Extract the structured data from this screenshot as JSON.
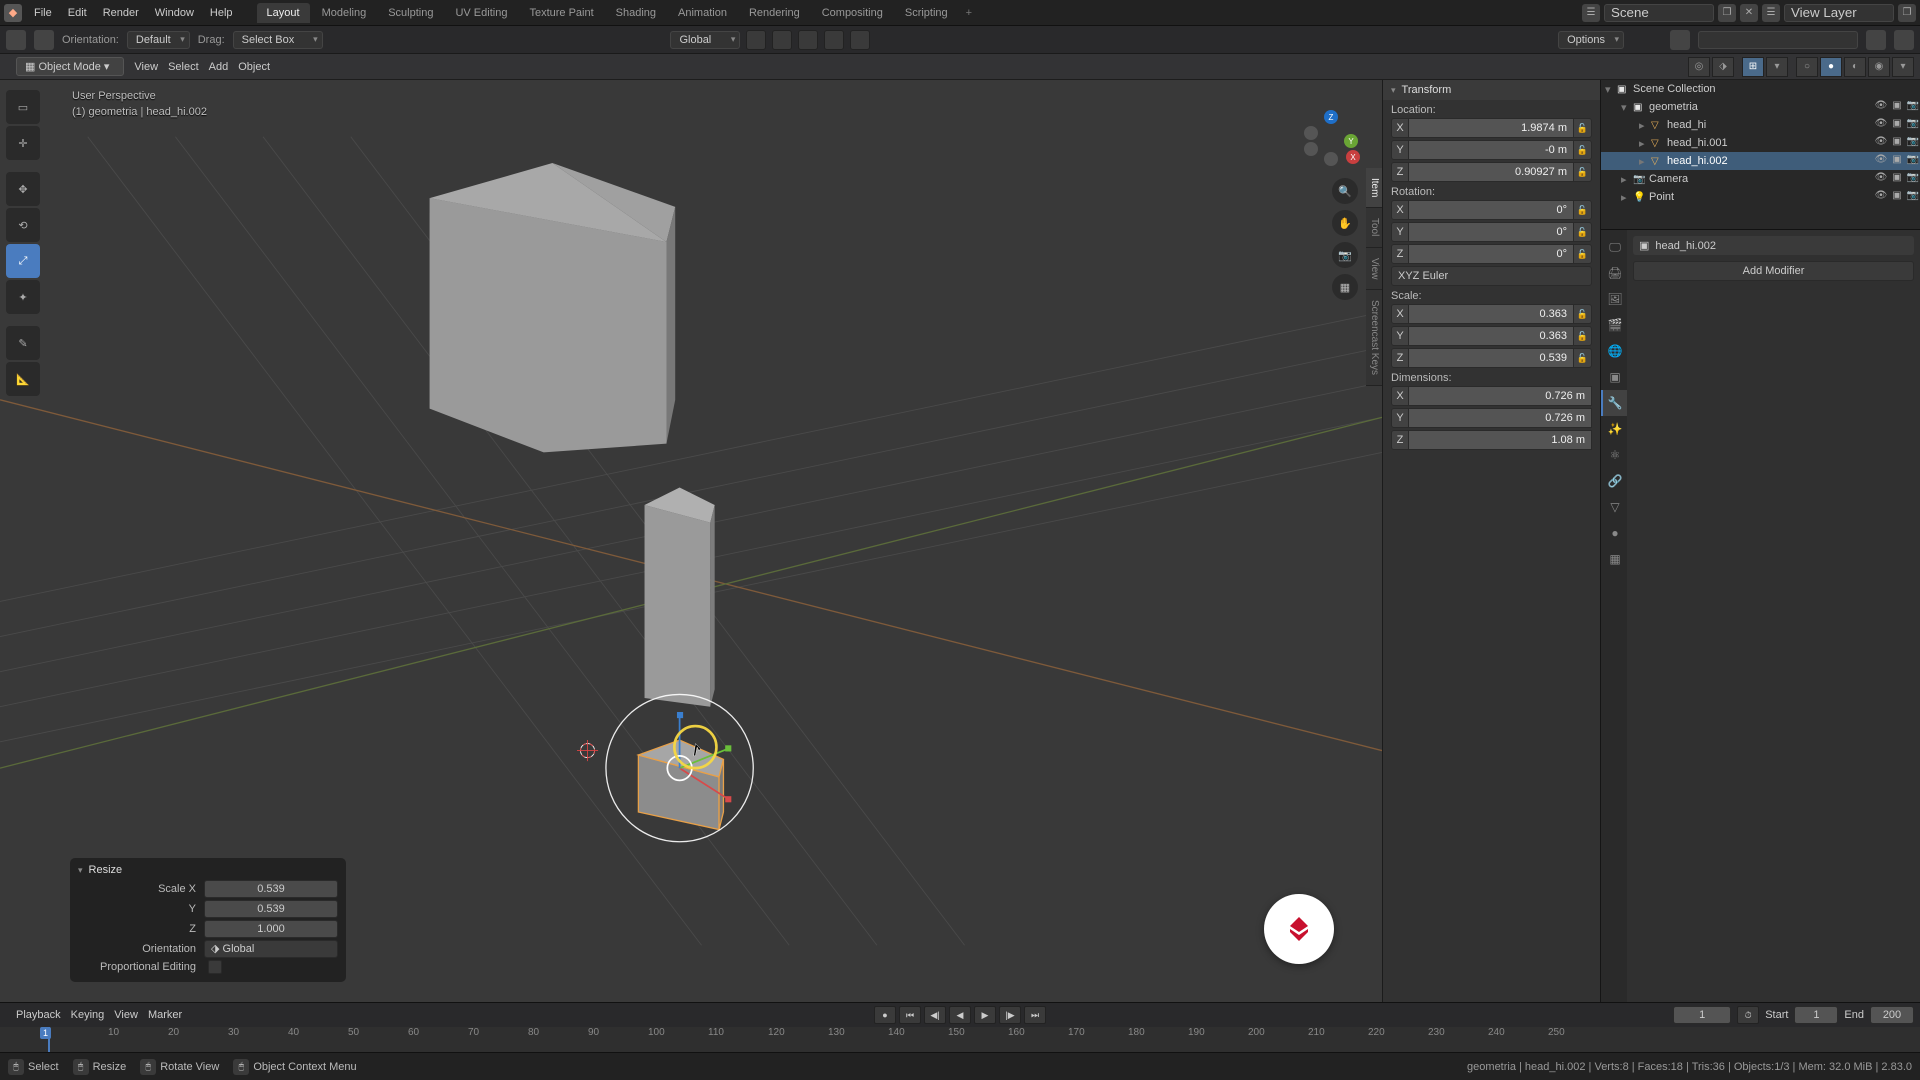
{
  "topbar": {
    "menus": [
      "File",
      "Edit",
      "Render",
      "Window",
      "Help"
    ],
    "workspaces": [
      "Layout",
      "Modeling",
      "Sculpting",
      "UV Editing",
      "Texture Paint",
      "Shading",
      "Animation",
      "Rendering",
      "Compositing",
      "Scripting"
    ],
    "active_ws": 0,
    "scene": "Scene",
    "view_layer": "View Layer"
  },
  "toolbar": {
    "orientation_lbl": "Orientation:",
    "orientation": "Default",
    "drag_lbl": "Drag:",
    "drag": "Select Box",
    "transform": "Global",
    "options": "Options"
  },
  "header3": {
    "mode": "Object Mode",
    "menus": [
      "View",
      "Select",
      "Add",
      "Object"
    ]
  },
  "viewport": {
    "persp": "User Perspective",
    "obj": "(1) geometria | head_hi.002",
    "side_tabs": [
      "Item",
      "Tool",
      "View",
      "Screencast Keys"
    ]
  },
  "npanel": {
    "header": "Transform",
    "location_lbl": "Location:",
    "loc": {
      "x": "1.9874 m",
      "y": "-0 m",
      "z": "0.90927 m"
    },
    "rotation_lbl": "Rotation:",
    "rot": {
      "x": "0°",
      "y": "0°",
      "z": "0°"
    },
    "rot_mode": "XYZ Euler",
    "scale_lbl": "Scale:",
    "scale": {
      "x": "0.363",
      "y": "0.363",
      "z": "0.539"
    },
    "dim_lbl": "Dimensions:",
    "dim": {
      "x": "0.726 m",
      "y": "0.726 m",
      "z": "1.08 m"
    }
  },
  "outliner": {
    "root": "Scene Collection",
    "items": [
      {
        "name": "geometria",
        "type": "collection",
        "depth": 1
      },
      {
        "name": "head_hi",
        "type": "mesh",
        "depth": 2
      },
      {
        "name": "head_hi.001",
        "type": "mesh",
        "depth": 2
      },
      {
        "name": "head_hi.002",
        "type": "mesh",
        "depth": 2,
        "sel": true
      },
      {
        "name": "Camera",
        "type": "camera",
        "depth": 1
      },
      {
        "name": "Point",
        "type": "light",
        "depth": 1
      }
    ]
  },
  "properties": {
    "crumb": "head_hi.002",
    "add_modifier": "Add Modifier"
  },
  "resize": {
    "title": "Resize",
    "sx_lbl": "Scale X",
    "y_lbl": "Y",
    "z_lbl": "Z",
    "sx": "0.539",
    "sy": "0.539",
    "sz": "1.000",
    "orient_lbl": "Orientation",
    "orient": "Global",
    "prop_lbl": "Proportional Editing"
  },
  "timeline": {
    "menus": [
      "Playback",
      "Keying",
      "View",
      "Marker"
    ],
    "ticks": [
      "10",
      "20",
      "30",
      "40",
      "50",
      "60",
      "70",
      "80",
      "90",
      "100",
      "110",
      "120",
      "130",
      "140",
      "150",
      "160",
      "170",
      "180",
      "190",
      "200",
      "210",
      "220",
      "230",
      "240",
      "250"
    ],
    "current": "1",
    "start_lbl": "Start",
    "start": "1",
    "end_lbl": "End",
    "end": "200"
  },
  "status": {
    "select": "Select",
    "resize": "Resize",
    "rotate": "Rotate View",
    "ctx": "Object Context Menu",
    "right": "geometria | head_hi.002 | Verts:8 | Faces:18 | Tris:36 | Objects:1/3 | Mem: 32.0 MiB | 2.83.0"
  }
}
